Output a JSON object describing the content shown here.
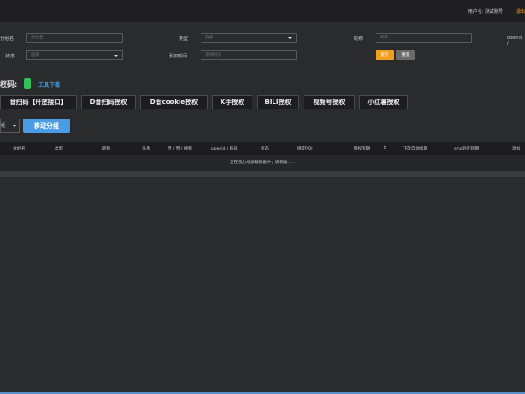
{
  "header": {
    "user": "用户名: 测试账号",
    "exit": "退出"
  },
  "filters": {
    "group_name_label": "分组名",
    "group_name_placeholder": "分组名",
    "type_label": "类型",
    "type_value": "选择",
    "nickname_label": "昵称",
    "nickname_placeholder": "昵称",
    "openid_label": "openid /",
    "status_label": "状态",
    "status_value": "选择",
    "added_time_label": "添加时间",
    "added_time_placeholder": "添加时间",
    "submit": "提交",
    "reset": "重置"
  },
  "auth": {
    "label": "权码:",
    "tool_download": "工具下载",
    "buttons": [
      "音扫码【开放接口】",
      "D音扫码授权",
      "D音cookie授权",
      "K手授权",
      "BILI授权",
      "视频号授权",
      "小红薯授权"
    ]
  },
  "group": {
    "select_value": "组",
    "move_button": "移动分组"
  },
  "table": {
    "headers": [
      "分组名",
      "类型",
      "昵称",
      "头像",
      "赞 / 赞 / 视频",
      "openid / 账号",
      "状态",
      "绑定POI",
      "授权到期",
      "下次自动续期",
      "sms验证到期",
      "添加"
    ],
    "loading": "正在努力地加载数据中，请稍候......"
  }
}
